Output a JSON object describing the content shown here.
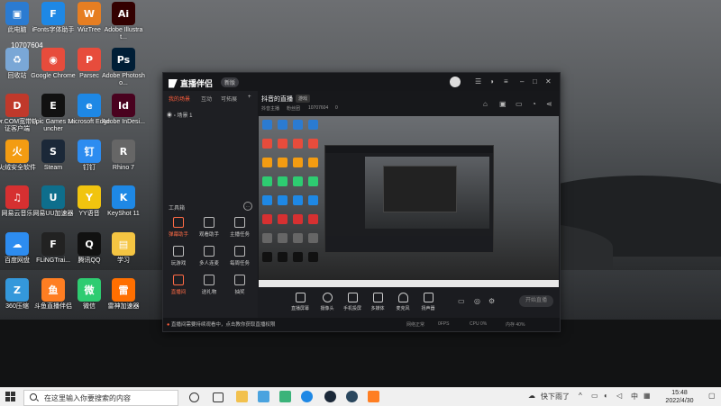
{
  "desktop": {
    "icons": [
      {
        "id": "this-pc",
        "label": "此电脑",
        "color": "#2b7bd1",
        "glyph": "▣"
      },
      {
        "id": "recycle-bin",
        "label": "回收站",
        "color": "#7aa7d6",
        "glyph": "♻"
      },
      {
        "id": "drcom",
        "label": "Dr.COM宽带认证客户端",
        "color": "#c0392b",
        "glyph": "D"
      },
      {
        "id": "huorong",
        "label": "火绒安全软件",
        "color": "#f39c12",
        "glyph": "火"
      },
      {
        "id": "netease-music",
        "label": "网易云音乐",
        "color": "#d63031",
        "glyph": "♫"
      },
      {
        "id": "baidu-netdisk",
        "label": "百度网盘",
        "color": "#2d8cf0",
        "glyph": "☁"
      },
      {
        "id": "360-zip",
        "label": "360压缩",
        "color": "#3498db",
        "glyph": "Z"
      },
      {
        "id": "ifonts",
        "label": "iFonts字体助手",
        "color": "#1e88e5",
        "glyph": "F"
      },
      {
        "id": "google-chrome",
        "label": "Google Chrome",
        "color": "#e74c3c",
        "glyph": "◉"
      },
      {
        "id": "epic-games",
        "label": "Epic Games Launcher",
        "color": "#111",
        "glyph": "E"
      },
      {
        "id": "steam",
        "label": "Steam",
        "color": "#1b2838",
        "glyph": "S"
      },
      {
        "id": "uu-booster",
        "label": "网易UU加速器",
        "color": "#0e6e8c",
        "glyph": "U"
      },
      {
        "id": "flingtrainer",
        "label": "FLiNGTrai...",
        "color": "#222",
        "glyph": "F"
      },
      {
        "id": "douyu",
        "label": "斗鱼直播伴侣",
        "color": "#ff7e22",
        "glyph": "鱼"
      },
      {
        "id": "wiztree",
        "label": "WizTree",
        "color": "#e67e22",
        "glyph": "W"
      },
      {
        "id": "parsec",
        "label": "Parsec",
        "color": "#e74c3c",
        "glyph": "P"
      },
      {
        "id": "edge",
        "label": "Microsoft Edge",
        "color": "#1e88e5",
        "glyph": "e"
      },
      {
        "id": "dingtalk",
        "label": "钉钉",
        "color": "#2d8cf0",
        "glyph": "钉"
      },
      {
        "id": "yy-voice",
        "label": "YY语音",
        "color": "#f1c40f",
        "glyph": "Y"
      },
      {
        "id": "qq",
        "label": "腾讯QQ",
        "color": "#111",
        "glyph": "Q"
      },
      {
        "id": "wechat",
        "label": "微信",
        "color": "#2ecc71",
        "glyph": "微"
      },
      {
        "id": "illustrator",
        "label": "Adobe Illustrat...",
        "color": "#330000",
        "glyph": "Ai"
      },
      {
        "id": "photoshop",
        "label": "Adobe Photosho...",
        "color": "#001e36",
        "glyph": "Ps"
      },
      {
        "id": "indesign",
        "label": "Adobe InDesi...",
        "color": "#49021f",
        "glyph": "Id"
      },
      {
        "id": "rhino",
        "label": "Rhino 7",
        "color": "#666",
        "glyph": "R"
      },
      {
        "id": "keyshot",
        "label": "KeyShot 11",
        "color": "#1e88e5",
        "glyph": "K"
      },
      {
        "id": "study-folder",
        "label": "学习",
        "color": "#f5c542",
        "glyph": "▤"
      },
      {
        "id": "leishen",
        "label": "雷神加速器",
        "color": "#ff6f00",
        "glyph": "雷"
      }
    ],
    "id_overlay": "10707604"
  },
  "app": {
    "name": "直播伴侣",
    "version": "新版",
    "left_tabs": [
      "我的场景",
      "互动",
      "可拓展"
    ],
    "add_label": "+",
    "scene_label": "场景 1",
    "tools_title": "工具箱",
    "tools": [
      {
        "label": "弹幕助手",
        "hot": true
      },
      {
        "label": "观看助手",
        "hot": false
      },
      {
        "label": "主播任务",
        "hot": false
      },
      {
        "label": "玩游戏",
        "hot": false
      },
      {
        "label": "多人连麦",
        "hot": false
      },
      {
        "label": "每周任务",
        "hot": false
      },
      {
        "label": "直播间",
        "hot": true
      },
      {
        "label": "送礼物",
        "hot": false
      },
      {
        "label": "抽奖",
        "hot": false
      }
    ],
    "main_title": "抖音的直播",
    "main_badge": "游戏",
    "meta": [
      "抖音主播",
      "粉丝团",
      "10707604",
      "0"
    ],
    "controls": [
      "直播屏幕",
      "摄像头",
      "手机投屏",
      "多媒体",
      "麦克风",
      "扬声器"
    ],
    "start_label": "开始直播",
    "notice": "直播间需要持续观看中，点击教你获取直播权限",
    "stats": [
      "网络正常",
      "0FPS",
      "CPU 0%",
      "内存 40%"
    ]
  },
  "taskbar": {
    "search_placeholder": "在这里输入你要搜索的内容",
    "weather": "快下雨了",
    "lang": "中",
    "time": "15:48",
    "date": "2022/4/30"
  }
}
